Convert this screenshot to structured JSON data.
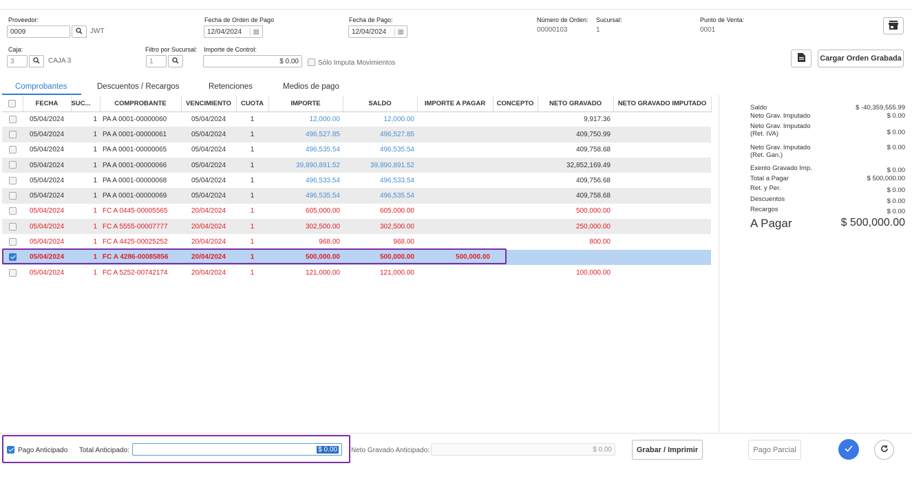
{
  "header": {
    "proveedor_label": "Proveedor:",
    "proveedor_code": "0009",
    "proveedor_name": "JWT",
    "fecha_orden_label": "Fecha de Orden de Pago",
    "fecha_orden": "12/04/2024",
    "fecha_pago_label": "Fecha de Pago:",
    "fecha_pago": "12/04/2024",
    "numero_orden_label": "Número de Orden:",
    "numero_orden": "00000103",
    "sucursal_label": "Sucursal:",
    "sucursal": "1",
    "punto_venta_label": "Punto de Venta:",
    "punto_venta": "0001",
    "caja_label": "Caja:",
    "caja_code": "3",
    "caja_name": "CAJA 3",
    "filtro_label": "Filtro por Sucursal:",
    "filtro_value": "1",
    "importe_control_label": "Importe de Control:",
    "importe_control": "$ 0.00",
    "solo_imputa_label": "Sólo Imputa Movimientos",
    "cargar_button": "Cargar Orden Grabada"
  },
  "tabs": [
    "Comprobantes",
    "Descuentos / Recargos",
    "Retenciones",
    "Medios de pago"
  ],
  "columns": [
    "FECHA",
    "SUC...",
    "COMPROBANTE",
    "VENCIMIENTO",
    "CUOTA",
    "IMPORTE",
    "SALDO",
    "IMPORTE A PAGAR",
    "CONCEPTO",
    "NETO GRAVADO",
    "NETO GRAVADO IMPUTADO"
  ],
  "rows": [
    {
      "fecha": "05/04/2024",
      "suc": "1",
      "comp": "PA A 0001-00000060",
      "venc": "05/04/2024",
      "cuota": "1",
      "importe": "12,000.00",
      "saldo": "12,000.00",
      "pagar": "",
      "concepto": "",
      "neto": "9,917.36",
      "imput": ""
    },
    {
      "fecha": "05/04/2024",
      "suc": "1",
      "comp": "PA A 0001-00000061",
      "venc": "05/04/2024",
      "cuota": "1",
      "importe": "496,527.85",
      "saldo": "496,527.85",
      "pagar": "",
      "concepto": "",
      "neto": "409,750.99",
      "imput": ""
    },
    {
      "fecha": "05/04/2024",
      "suc": "1",
      "comp": "PA A 0001-00000065",
      "venc": "05/04/2024",
      "cuota": "1",
      "importe": "496,535.54",
      "saldo": "496,535.54",
      "pagar": "",
      "concepto": "",
      "neto": "409,758.68",
      "imput": ""
    },
    {
      "fecha": "05/04/2024",
      "suc": "1",
      "comp": "PA A 0001-00000066",
      "venc": "05/04/2024",
      "cuota": "1",
      "importe": "39,890,891.52",
      "saldo": "39,890,891.52",
      "pagar": "",
      "concepto": "",
      "neto": "32,852,169.49",
      "imput": ""
    },
    {
      "fecha": "05/04/2024",
      "suc": "1",
      "comp": "PA A 0001-00000068",
      "venc": "05/04/2024",
      "cuota": "1",
      "importe": "496,533.54",
      "saldo": "496,533.54",
      "pagar": "",
      "concepto": "",
      "neto": "409,756.68",
      "imput": ""
    },
    {
      "fecha": "05/04/2024",
      "suc": "1",
      "comp": "PA A 0001-00000069",
      "venc": "05/04/2024",
      "cuota": "1",
      "importe": "496,535.54",
      "saldo": "496,535.54",
      "pagar": "",
      "concepto": "",
      "neto": "409,758.68",
      "imput": ""
    },
    {
      "fecha": "05/04/2024",
      "suc": "1",
      "comp": "FC A 0445-00005565",
      "venc": "20/04/2024",
      "cuota": "1",
      "importe": "605,000.00",
      "saldo": "605,000.00",
      "pagar": "",
      "concepto": "",
      "neto": "500,000.00",
      "imput": ""
    },
    {
      "fecha": "05/04/2024",
      "suc": "1",
      "comp": "FC A 5555-00007777",
      "venc": "20/04/2024",
      "cuota": "1",
      "importe": "302,500.00",
      "saldo": "302,500.00",
      "pagar": "",
      "concepto": "",
      "neto": "250,000.00",
      "imput": ""
    },
    {
      "fecha": "05/04/2024",
      "suc": "1",
      "comp": "FC A 4425-00025252",
      "venc": "20/04/2024",
      "cuota": "1",
      "importe": "968.00",
      "saldo": "968.00",
      "pagar": "",
      "concepto": "",
      "neto": "800.00",
      "imput": ""
    },
    {
      "fecha": "05/04/2024",
      "suc": "1",
      "comp": "FC A 4286-00085856",
      "venc": "20/04/2024",
      "cuota": "1",
      "importe": "500,000.00",
      "saldo": "500,000.00",
      "pagar": "500,000.00",
      "concepto": "",
      "neto": "",
      "imput": ""
    },
    {
      "fecha": "05/04/2024",
      "suc": "1",
      "comp": "FC A 5252-00742174",
      "venc": "20/04/2024",
      "cuota": "1",
      "importe": "121,000.00",
      "saldo": "121,000.00",
      "pagar": "",
      "concepto": "",
      "neto": "100,000.00",
      "imput": ""
    }
  ],
  "summary": {
    "saldo_label": "Saldo",
    "saldo": "$ -40,359,555.99",
    "ngi_label": "Neto Grav. Imputado",
    "ngi": "$ 0.00",
    "ngi_iva_label1": "Neto Grav. Imputado",
    "ngi_iva_label2": "(Ret. IVA)",
    "ngi_iva": "$ 0.00",
    "ngi_gan_label1": "Neto Grav. Imputado",
    "ngi_gan_label2": "(Ret. Gan.)",
    "ngi_gan": "$ 0.00",
    "exento_label": "Exento Gravado Imp.",
    "exento": "$ 0.00",
    "total_label": "Total a Pagar",
    "total": "$ 500,000.00",
    "ret_label": "Ret. y Per.",
    "ret": "$ 0.00",
    "desc_label": "Descuentos",
    "desc": "$ 0.00",
    "rec_label": "Recargos",
    "rec": "$ 0.00",
    "apagar_label": "A Pagar",
    "apagar": "$ 500,000.00"
  },
  "footer": {
    "pago_anticipado_label": "Pago Anticipado",
    "total_anticipado_label": "Total Anticipado:",
    "total_anticipado": "$ 0.00",
    "neto_anticipado_label": "Neto Gravado Anticipado:",
    "neto_anticipado": "$ 0.00",
    "grabar_button": "Grabar / Imprimir",
    "pago_parcial_button": "Pago Parcial"
  }
}
